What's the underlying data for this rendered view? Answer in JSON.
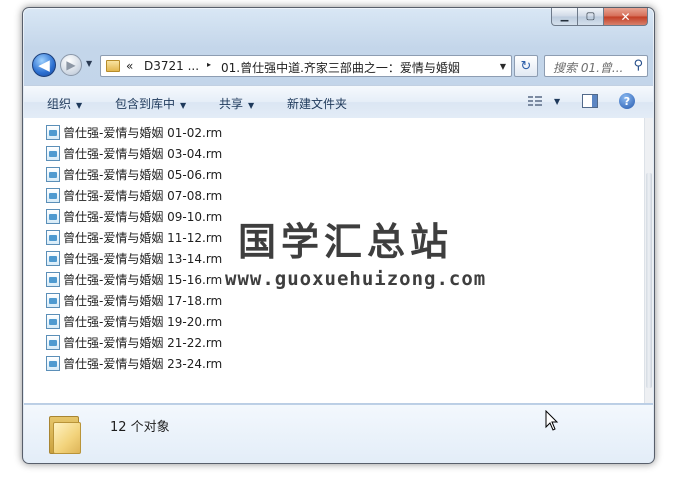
{
  "window": {
    "caption_buttons": [
      {
        "name": "minimize-button",
        "glyph": "▁"
      },
      {
        "name": "maximize-button",
        "glyph": "▢"
      },
      {
        "name": "close-button",
        "glyph": "✕"
      }
    ]
  },
  "nav": {
    "back_glyph": "◀",
    "forward_glyph": "▶",
    "history_dropdown_glyph": "▼"
  },
  "address": {
    "overflow": "«",
    "segment1": "D3721 ...",
    "separator": "▸",
    "segment2": "01.曾仕强中道.齐家三部曲之一：爱情与婚姻",
    "dropdown_glyph": "▼"
  },
  "refresh_glyph": "↻",
  "search": {
    "placeholder": "搜索 01.曾...",
    "icon": "⚲"
  },
  "toolbar": {
    "organize": "组织",
    "include_in_library": "包含到库中",
    "share": "共享",
    "new_folder": "新建文件夹",
    "dropdown_glyph": "▼",
    "help": "?"
  },
  "files": [
    "曾仕强-爱情与婚姻 01-02.rm",
    "曾仕强-爱情与婚姻 03-04.rm",
    "曾仕强-爱情与婚姻 05-06.rm",
    "曾仕强-爱情与婚姻 07-08.rm",
    "曾仕强-爱情与婚姻 09-10.rm",
    "曾仕强-爱情与婚姻 11-12.rm",
    "曾仕强-爱情与婚姻 13-14.rm",
    "曾仕强-爱情与婚姻 15-16.rm",
    "曾仕强-爱情与婚姻 17-18.rm",
    "曾仕强-爱情与婚姻 19-20.rm",
    "曾仕强-爱情与婚姻 21-22.rm",
    "曾仕强-爱情与婚姻 23-24.rm"
  ],
  "watermark": {
    "title": "国学汇总站",
    "url": "www.guoxuehuizong.com"
  },
  "details": {
    "count": "12 个对象"
  },
  "colors": {
    "accent": "#2b6fd1",
    "toolbar_text": "#1e395b",
    "close": "#c23c23"
  }
}
